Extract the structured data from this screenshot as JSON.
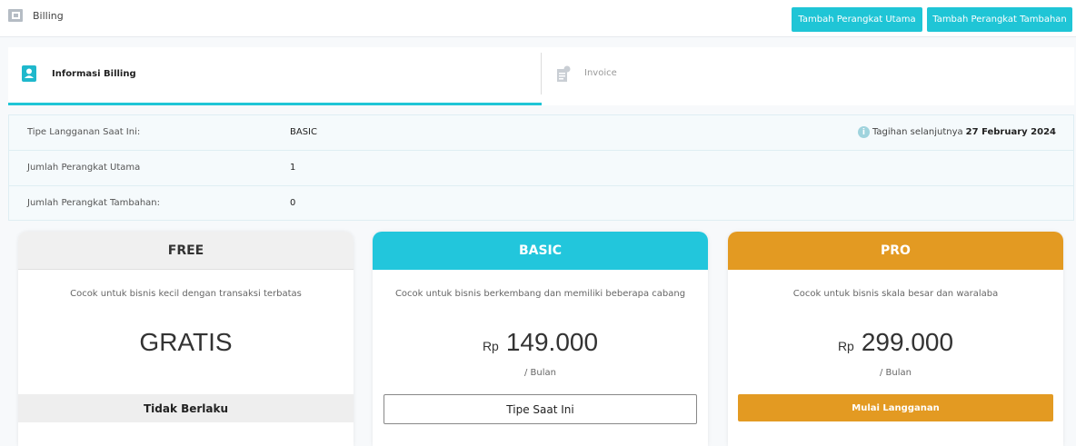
{
  "header": {
    "title": "Billing",
    "icon": "wallet-icon",
    "buttons": {
      "add_main_device": "Tambah Perangkat Utama",
      "add_extra_device": "Tambah Perangkat Tambahan"
    },
    "accent_color": "#1fc5d6"
  },
  "tabs": [
    {
      "label": "Informasi Billing",
      "icon": "user-card-icon",
      "active": true
    },
    {
      "label": "Invoice",
      "icon": "invoice-icon",
      "active": false
    }
  ],
  "info": {
    "rows": [
      {
        "label": "Tipe Langganan Saat Ini:",
        "value": "BASIC"
      },
      {
        "label": "Jumlah Perangkat Utama",
        "value": "1"
      },
      {
        "label": "Jumlah Perangkat Tambahan:",
        "value": "0"
      }
    ],
    "next_bill_label": "Tagihan selanjutnya",
    "next_bill_date": "27 February 2024"
  },
  "plans": {
    "free": {
      "name": "FREE",
      "description": "Cocok untuk bisnis kecil dengan transaksi terbatas",
      "price_text": "GRATIS",
      "status": "Tidak Berlaku"
    },
    "basic": {
      "name": "BASIC",
      "description": "Cocok untuk bisnis berkembang dan memiliki beberapa cabang",
      "currency": "Rp",
      "amount": "149.000",
      "period": "/ Bulan",
      "button": "Tipe Saat Ini",
      "color": "#22c6dc"
    },
    "pro": {
      "name": "PRO",
      "description": "Cocok untuk bisnis skala besar dan waralaba",
      "currency": "Rp",
      "amount": "299.000",
      "period": "/ Bulan",
      "button": "Mulai Langganan",
      "color": "#e39a22"
    }
  }
}
